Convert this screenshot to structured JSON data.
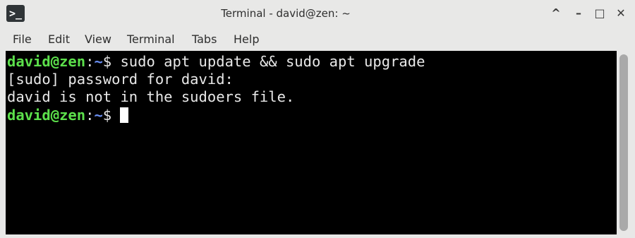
{
  "window": {
    "title": "Terminal - david@zen: ~",
    "app_icon_glyph": ">_",
    "controls": {
      "keep_above": "^",
      "minimize": "–",
      "maximize": "□",
      "close": "✕"
    }
  },
  "menu": {
    "items": [
      "File",
      "Edit",
      "View",
      "Terminal",
      "Tabs",
      "Help"
    ]
  },
  "terminal": {
    "lines": [
      {
        "user_host": "david@zen",
        "sep": ":",
        "path": "~",
        "symbol": "$ ",
        "command": "sudo apt update && sudo apt upgrade"
      },
      {
        "text": "[sudo] password for david:"
      },
      {
        "text": "david is not in the sudoers file."
      },
      {
        "user_host": "david@zen",
        "sep": ":",
        "path": "~",
        "symbol": "$ ",
        "command": ""
      }
    ]
  },
  "colors": {
    "prompt_user": "#5ce04b",
    "prompt_path": "#6a8ff3",
    "terminal_bg": "#000000",
    "terminal_fg": "#e8e8e8"
  }
}
